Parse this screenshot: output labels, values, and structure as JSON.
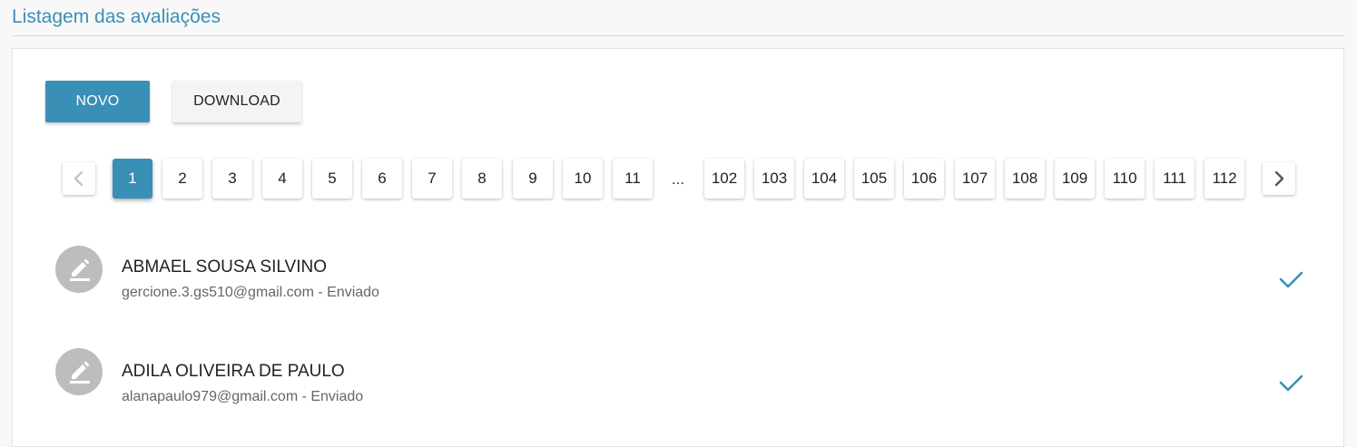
{
  "page": {
    "title": "Listagem das avaliações"
  },
  "toolbar": {
    "new_label": "NOVO",
    "download_label": "DOWNLOAD"
  },
  "pagination": {
    "current_page": "1",
    "pages": [
      "1",
      "2",
      "3",
      "4",
      "5",
      "6",
      "7",
      "8",
      "9",
      "10",
      "11",
      "102",
      "103",
      "104",
      "105",
      "106",
      "107",
      "108",
      "109",
      "110",
      "111",
      "112"
    ],
    "ellipsis": "...",
    "prev_icon": "chevron-left-icon",
    "next_icon": "chevron-right-icon"
  },
  "evaluations": [
    {
      "name": "ABMAEL SOUSA SILVINO",
      "email": "gercione.3.gs510@gmail.com - Enviado",
      "icon": "edit-icon",
      "status_icon": "check-icon"
    },
    {
      "name": "ADILA OLIVEIRA DE PAULO",
      "email": "alanapaulo979@gmail.com - Enviado",
      "icon": "edit-icon",
      "status_icon": "check-icon"
    }
  ],
  "colors": {
    "accent": "#3a8fb7",
    "avatar": "#bdbdbd",
    "page_background": "#f8f8f8"
  }
}
